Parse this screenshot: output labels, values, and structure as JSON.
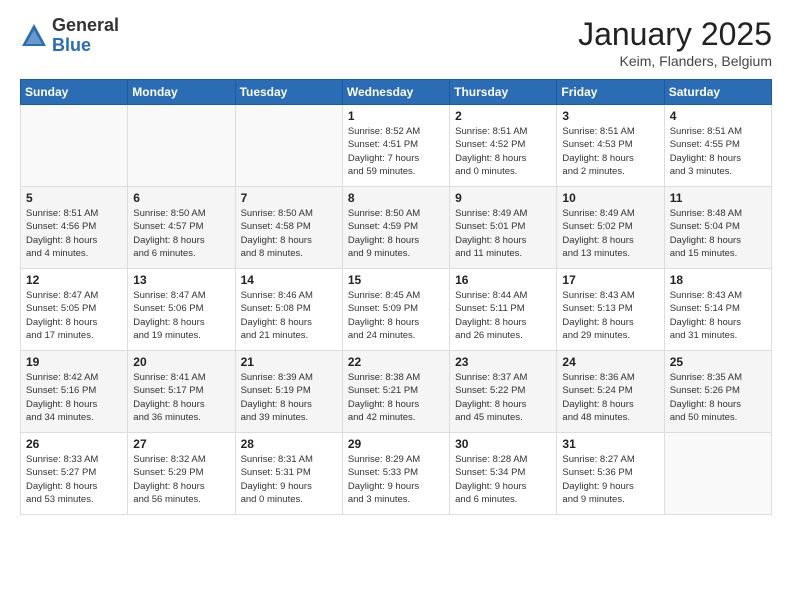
{
  "header": {
    "logo_general": "General",
    "logo_blue": "Blue",
    "title": "January 2025",
    "location": "Keim, Flanders, Belgium"
  },
  "weekdays": [
    "Sunday",
    "Monday",
    "Tuesday",
    "Wednesday",
    "Thursday",
    "Friday",
    "Saturday"
  ],
  "weeks": [
    [
      {
        "day": "",
        "info": ""
      },
      {
        "day": "",
        "info": ""
      },
      {
        "day": "",
        "info": ""
      },
      {
        "day": "1",
        "info": "Sunrise: 8:52 AM\nSunset: 4:51 PM\nDaylight: 7 hours\nand 59 minutes."
      },
      {
        "day": "2",
        "info": "Sunrise: 8:51 AM\nSunset: 4:52 PM\nDaylight: 8 hours\nand 0 minutes."
      },
      {
        "day": "3",
        "info": "Sunrise: 8:51 AM\nSunset: 4:53 PM\nDaylight: 8 hours\nand 2 minutes."
      },
      {
        "day": "4",
        "info": "Sunrise: 8:51 AM\nSunset: 4:55 PM\nDaylight: 8 hours\nand 3 minutes."
      }
    ],
    [
      {
        "day": "5",
        "info": "Sunrise: 8:51 AM\nSunset: 4:56 PM\nDaylight: 8 hours\nand 4 minutes."
      },
      {
        "day": "6",
        "info": "Sunrise: 8:50 AM\nSunset: 4:57 PM\nDaylight: 8 hours\nand 6 minutes."
      },
      {
        "day": "7",
        "info": "Sunrise: 8:50 AM\nSunset: 4:58 PM\nDaylight: 8 hours\nand 8 minutes."
      },
      {
        "day": "8",
        "info": "Sunrise: 8:50 AM\nSunset: 4:59 PM\nDaylight: 8 hours\nand 9 minutes."
      },
      {
        "day": "9",
        "info": "Sunrise: 8:49 AM\nSunset: 5:01 PM\nDaylight: 8 hours\nand 11 minutes."
      },
      {
        "day": "10",
        "info": "Sunrise: 8:49 AM\nSunset: 5:02 PM\nDaylight: 8 hours\nand 13 minutes."
      },
      {
        "day": "11",
        "info": "Sunrise: 8:48 AM\nSunset: 5:04 PM\nDaylight: 8 hours\nand 15 minutes."
      }
    ],
    [
      {
        "day": "12",
        "info": "Sunrise: 8:47 AM\nSunset: 5:05 PM\nDaylight: 8 hours\nand 17 minutes."
      },
      {
        "day": "13",
        "info": "Sunrise: 8:47 AM\nSunset: 5:06 PM\nDaylight: 8 hours\nand 19 minutes."
      },
      {
        "day": "14",
        "info": "Sunrise: 8:46 AM\nSunset: 5:08 PM\nDaylight: 8 hours\nand 21 minutes."
      },
      {
        "day": "15",
        "info": "Sunrise: 8:45 AM\nSunset: 5:09 PM\nDaylight: 8 hours\nand 24 minutes."
      },
      {
        "day": "16",
        "info": "Sunrise: 8:44 AM\nSunset: 5:11 PM\nDaylight: 8 hours\nand 26 minutes."
      },
      {
        "day": "17",
        "info": "Sunrise: 8:43 AM\nSunset: 5:13 PM\nDaylight: 8 hours\nand 29 minutes."
      },
      {
        "day": "18",
        "info": "Sunrise: 8:43 AM\nSunset: 5:14 PM\nDaylight: 8 hours\nand 31 minutes."
      }
    ],
    [
      {
        "day": "19",
        "info": "Sunrise: 8:42 AM\nSunset: 5:16 PM\nDaylight: 8 hours\nand 34 minutes."
      },
      {
        "day": "20",
        "info": "Sunrise: 8:41 AM\nSunset: 5:17 PM\nDaylight: 8 hours\nand 36 minutes."
      },
      {
        "day": "21",
        "info": "Sunrise: 8:39 AM\nSunset: 5:19 PM\nDaylight: 8 hours\nand 39 minutes."
      },
      {
        "day": "22",
        "info": "Sunrise: 8:38 AM\nSunset: 5:21 PM\nDaylight: 8 hours\nand 42 minutes."
      },
      {
        "day": "23",
        "info": "Sunrise: 8:37 AM\nSunset: 5:22 PM\nDaylight: 8 hours\nand 45 minutes."
      },
      {
        "day": "24",
        "info": "Sunrise: 8:36 AM\nSunset: 5:24 PM\nDaylight: 8 hours\nand 48 minutes."
      },
      {
        "day": "25",
        "info": "Sunrise: 8:35 AM\nSunset: 5:26 PM\nDaylight: 8 hours\nand 50 minutes."
      }
    ],
    [
      {
        "day": "26",
        "info": "Sunrise: 8:33 AM\nSunset: 5:27 PM\nDaylight: 8 hours\nand 53 minutes."
      },
      {
        "day": "27",
        "info": "Sunrise: 8:32 AM\nSunset: 5:29 PM\nDaylight: 8 hours\nand 56 minutes."
      },
      {
        "day": "28",
        "info": "Sunrise: 8:31 AM\nSunset: 5:31 PM\nDaylight: 9 hours\nand 0 minutes."
      },
      {
        "day": "29",
        "info": "Sunrise: 8:29 AM\nSunset: 5:33 PM\nDaylight: 9 hours\nand 3 minutes."
      },
      {
        "day": "30",
        "info": "Sunrise: 8:28 AM\nSunset: 5:34 PM\nDaylight: 9 hours\nand 6 minutes."
      },
      {
        "day": "31",
        "info": "Sunrise: 8:27 AM\nSunset: 5:36 PM\nDaylight: 9 hours\nand 9 minutes."
      },
      {
        "day": "",
        "info": ""
      }
    ]
  ]
}
